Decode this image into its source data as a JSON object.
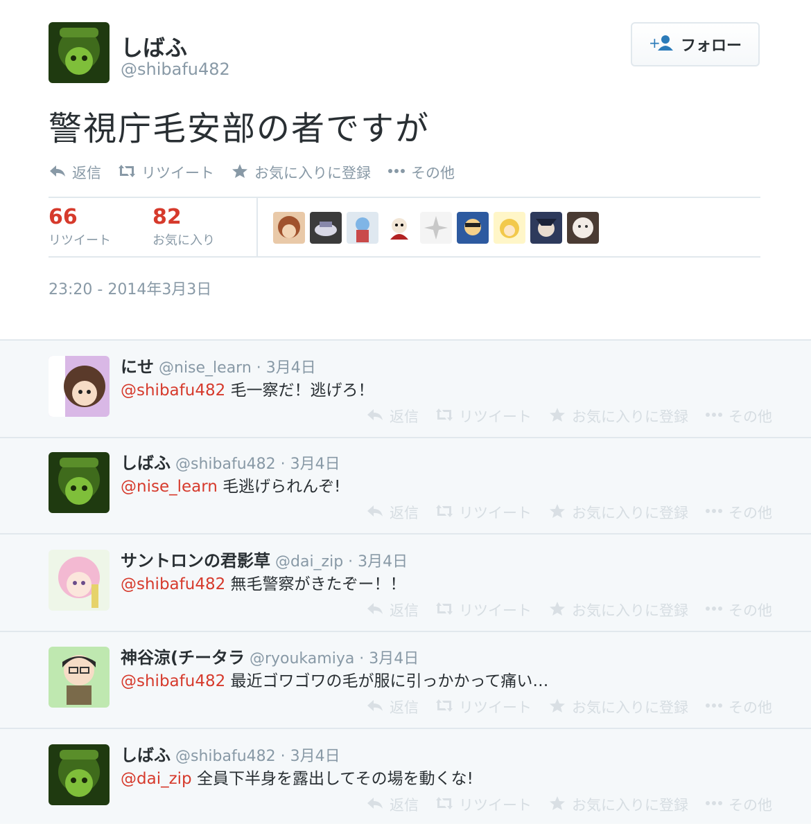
{
  "main_tweet": {
    "name": "しばふ",
    "handle": "@shibafu482",
    "follow_label": "フォロー",
    "text": "警視庁毛安部の者ですが",
    "actions": {
      "reply": "返信",
      "retweet": "リツイート",
      "favorite": "お気に入りに登録",
      "more": "その他"
    },
    "stats": {
      "retweets": "66",
      "retweets_label": "リツイート",
      "favorites": "82",
      "favorites_label": "お気に入り"
    },
    "timestamp": "23:20 - 2014年3月3日"
  },
  "reply_actions": {
    "reply": "返信",
    "retweet": "リツイート",
    "favorite": "お気に入りに登録",
    "more": "その他"
  },
  "replies": [
    {
      "name": "にせ",
      "meta": "@nise_learn · 3月4日",
      "mention": "@shibafu482",
      "text": " 毛一察だ！逃げろ！"
    },
    {
      "name": "しばふ",
      "meta": "@shibafu482 · 3月4日",
      "mention": "@nise_learn",
      "text": " 毛逃げられんぞ!"
    },
    {
      "name": "サントロンの君影草",
      "meta": "@dai_zip · 3月4日",
      "mention": "@shibafu482",
      "text": " 無毛警察がきたぞー！！"
    },
    {
      "name": "神谷涼(チータラ",
      "meta": "@ryoukamiya · 3月4日",
      "mention": "@shibafu482",
      "text": " 最近ゴワゴワの毛が服に引っかかって痛い…"
    },
    {
      "name": "しばふ",
      "meta": "@shibafu482 · 3月4日",
      "mention": "@dai_zip",
      "text": " 全員下半身を露出してその場を動くな!"
    }
  ],
  "icons": {
    "reply": "reply-arrow-icon",
    "retweet": "retweet-icon",
    "favorite": "star-icon",
    "more": "ellipsis-icon",
    "follow": "add-user-icon"
  },
  "colors": {
    "mention": "#d63a2c",
    "stat_number": "#d63a2c",
    "muted": "#8899a6",
    "reply_bg": "#f5f8fa"
  }
}
